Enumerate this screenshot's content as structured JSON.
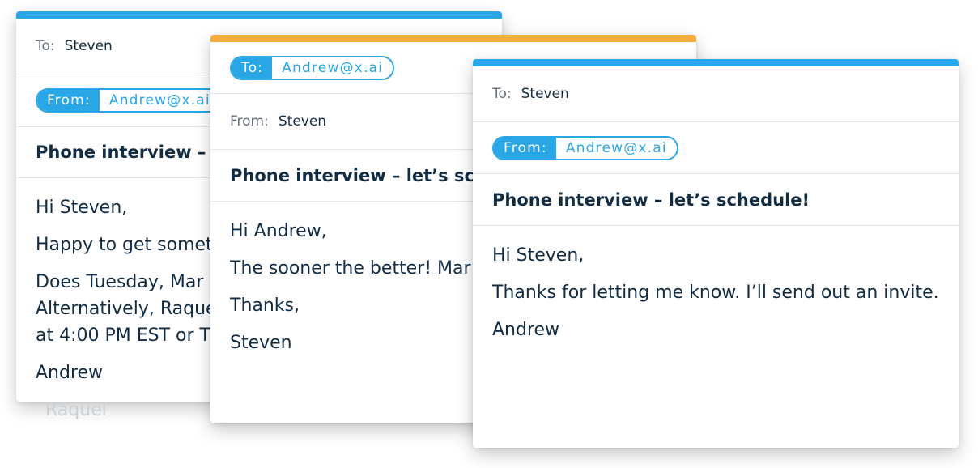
{
  "colors": {
    "accent_blue": "#29a6e6",
    "accent_orange": "#f4ac3c",
    "text_dark": "#122c44",
    "text_muted": "#66717c"
  },
  "emails": [
    {
      "to_label": "To:",
      "to_value": "Steven",
      "from_label": "From:",
      "from_value": "Andrew@x.ai",
      "subject": "Phone interview – let’s schedule!",
      "body": {
        "greeting": "Hi Steven,",
        "line1": "Happy to get something on the calendar.",
        "line2a": "Does Tuesday, Mar",
        "line2b": "Alternatively, Raquel",
        "line2c": "at 4:00 PM EST or T",
        "signature": "Andrew",
        "faded_signature": "Raquel"
      }
    },
    {
      "to_label": "To:",
      "to_value": "Andrew@x.ai",
      "from_label": "From:",
      "from_value": "Steven",
      "subject": "Phone interview – let’s schedule!",
      "body": {
        "greeting": "Hi Andrew,",
        "line1": "The sooner the better!  Mar",
        "thanks": "Thanks,",
        "signature": "Steven"
      }
    },
    {
      "to_label": "To:",
      "to_value": "Steven",
      "from_label": "From:",
      "from_value": "Andrew@x.ai",
      "subject": "Phone interview – let’s schedule!",
      "body": {
        "greeting": "Hi Steven,",
        "line1": "Thanks for letting me know. I’ll send out an invite.",
        "signature": "Andrew"
      }
    }
  ]
}
